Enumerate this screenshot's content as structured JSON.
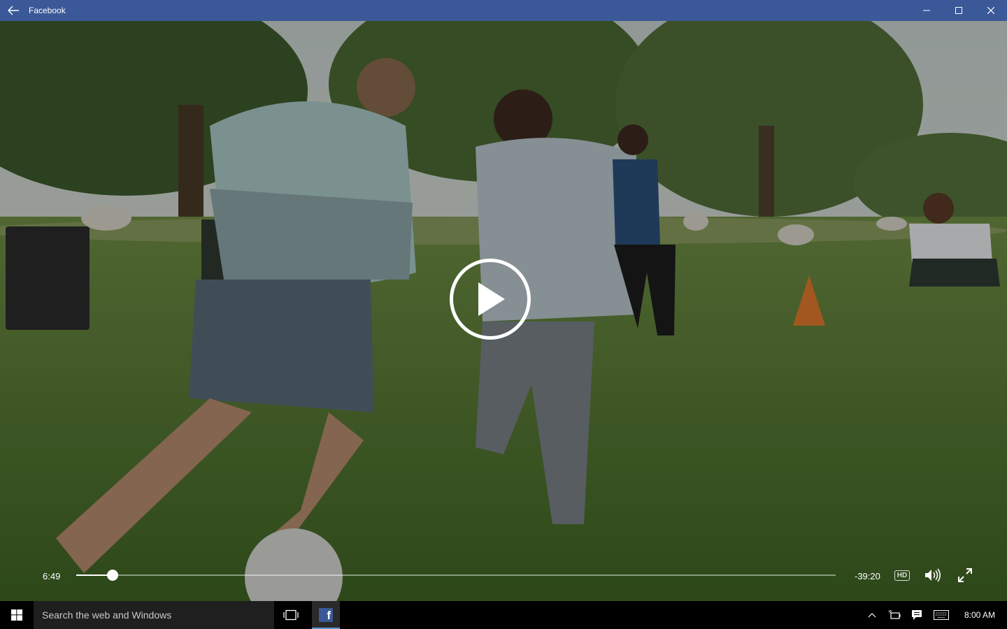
{
  "window": {
    "title": "Facebook"
  },
  "video": {
    "elapsed": "6:49",
    "remaining": "-39:20",
    "progress_fraction": 0.048,
    "quality_label": "HD"
  },
  "taskbar": {
    "search_placeholder": "Search the web and Windows",
    "clock": "8:00 AM"
  },
  "icons": {
    "back": "back-arrow-icon",
    "minimize": "minimize-icon",
    "maximize": "maximize-icon",
    "close": "close-icon",
    "play": "play-icon",
    "volume": "volume-icon",
    "fullscreen": "fullscreen-icon",
    "start": "windows-logo-icon",
    "task_view": "task-view-icon",
    "facebook": "facebook-icon"
  },
  "colors": {
    "titlebar": "#3b5998",
    "taskbar": "#000000",
    "search_box": "#1f1f1f"
  }
}
